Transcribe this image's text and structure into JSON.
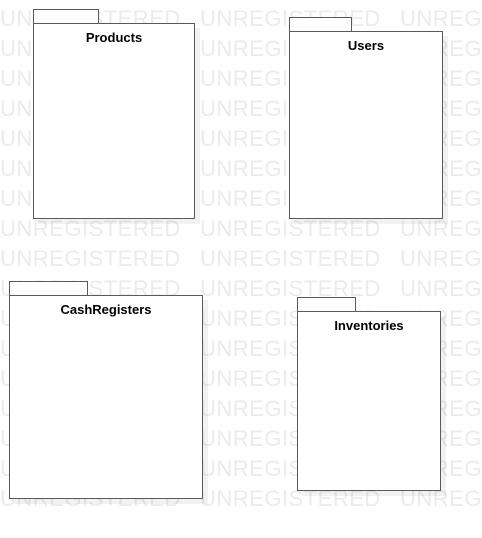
{
  "watermark": {
    "text": "UNREGISTERED"
  },
  "packages": {
    "products": {
      "name": "Products"
    },
    "users": {
      "name": "Users"
    },
    "cash_registers": {
      "name": "CashRegisters"
    },
    "inventories": {
      "name": "Inventories"
    }
  }
}
